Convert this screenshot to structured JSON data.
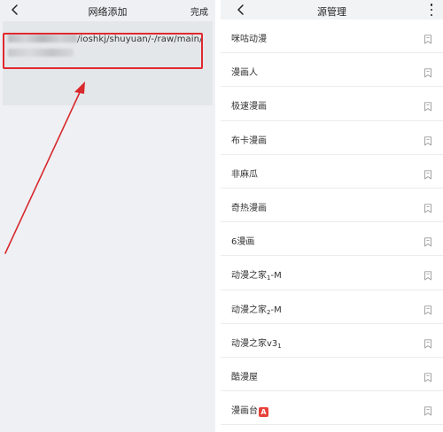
{
  "left_panel": {
    "title": "网络添加",
    "done_label": "完成",
    "url_text": "/ioshkj/shuyuan/-/raw/main/"
  },
  "right_panel": {
    "title": "源管理",
    "sources": [
      {
        "label": "咪咕动漫"
      },
      {
        "label": "漫画人"
      },
      {
        "label": "极速漫画"
      },
      {
        "label": "布卡漫画"
      },
      {
        "label": "非麻瓜"
      },
      {
        "label": "奇热漫画"
      },
      {
        "label": "6漫画"
      },
      {
        "label": "动漫之家",
        "sub": "1",
        "suffix": "-M"
      },
      {
        "label": "动漫之家",
        "sub": "2",
        "suffix": "-M"
      },
      {
        "label": "动漫之家v3",
        "sub": "1",
        "suffix": ""
      },
      {
        "label": "酷漫屋"
      },
      {
        "label": "漫画台",
        "badge": "A"
      }
    ]
  },
  "colors": {
    "highlight": "#e0292e",
    "badge": "#e8413a"
  },
  "icons": {
    "back": "chevron-left-icon",
    "more": "more-vertical-icon",
    "bookmark": "bookmark-icon"
  }
}
